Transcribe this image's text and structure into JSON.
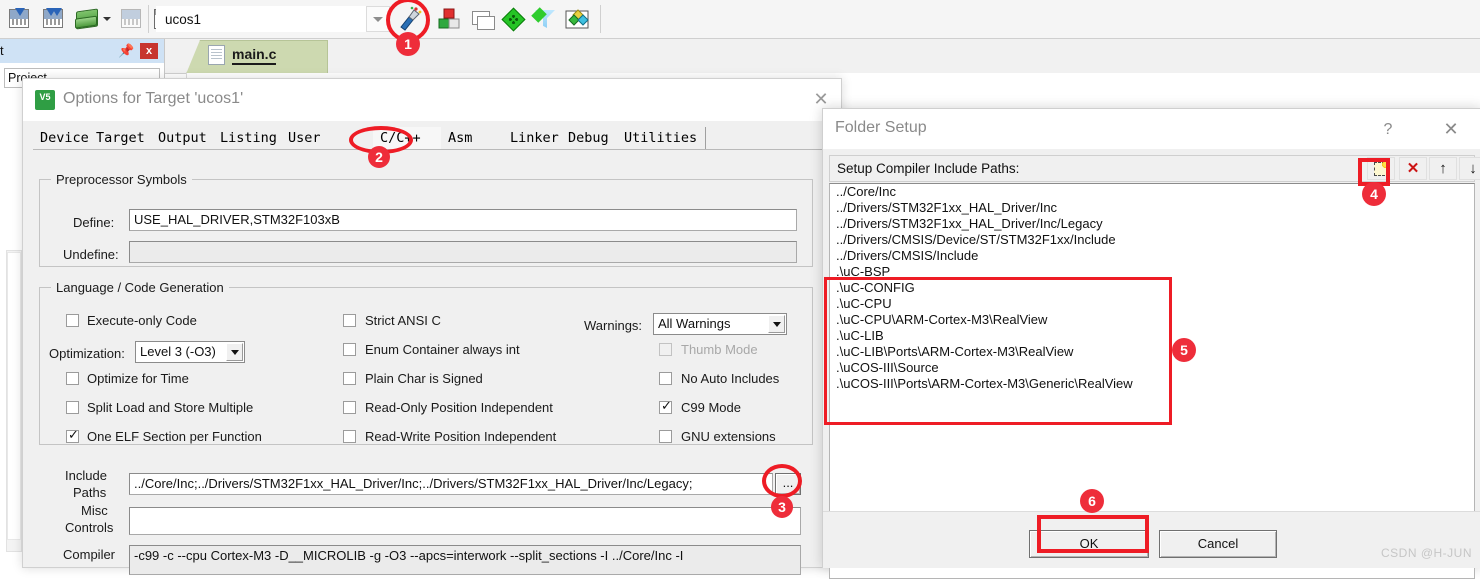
{
  "ide": {
    "toolbar": {
      "target_value": "ucos1",
      "icons": [
        {
          "name": "batch-build-icon"
        },
        {
          "name": "batch-rebuild-icon"
        },
        {
          "name": "manage-project-items-icon"
        },
        {
          "name": "dropdown-arrow-icon"
        },
        {
          "name": "clear-build-icon"
        },
        {
          "name": "load-download-icon"
        },
        {
          "name": "target-options-icon"
        },
        {
          "name": "manage-components-icon"
        },
        {
          "name": "multi-project-icon"
        },
        {
          "name": "configuration-wizard-icon"
        },
        {
          "name": "pack-installer-icon"
        },
        {
          "name": "pack-manager-icon"
        }
      ],
      "combo_arrow": "chevron-down-icon"
    },
    "project_panel": {
      "title": "t",
      "pin": "pin-icon",
      "close": "x",
      "combo_value": "Project"
    },
    "editor": {
      "tab_label": "main.c"
    }
  },
  "options_dialog": {
    "app_icon_text": "V5",
    "title": "Options for Target 'ucos1'",
    "close": "✕",
    "tabs": [
      {
        "label": "Device"
      },
      {
        "label": "Target"
      },
      {
        "label": "Output"
      },
      {
        "label": "Listing"
      },
      {
        "label": "User"
      },
      {
        "label": "C/C++"
      },
      {
        "label": "Asm"
      },
      {
        "label": "Linker"
      },
      {
        "label": "Debug"
      },
      {
        "label": "Utilities"
      }
    ],
    "active_tab": "C/C++",
    "preprocessor": {
      "legend": "Preprocessor Symbols",
      "define_label": "Define:",
      "define_value": "USE_HAL_DRIVER,STM32F103xB",
      "undefine_label": "Undefine:",
      "undefine_value": ""
    },
    "language": {
      "legend": "Language / Code Generation",
      "left_checks": [
        {
          "label": "Execute-only Code",
          "checked": false
        },
        {
          "label": "Optimize for Time",
          "checked": false
        },
        {
          "label": "Split Load and Store Multiple",
          "checked": false
        },
        {
          "label": "One ELF Section per Function",
          "checked": true
        }
      ],
      "optimization_label": "Optimization:",
      "optimization_value": "Level 3 (-O3)",
      "middle_checks": [
        {
          "label": "Strict ANSI C",
          "checked": false
        },
        {
          "label": "Enum Container always int",
          "checked": false
        },
        {
          "label": "Plain Char is Signed",
          "checked": false
        },
        {
          "label": "Read-Only Position Independent",
          "checked": false
        },
        {
          "label": "Read-Write Position Independent",
          "checked": false
        }
      ],
      "warnings_label": "Warnings:",
      "warnings_value": "All Warnings",
      "right_checks": [
        {
          "label": "Thumb Mode",
          "checked": false,
          "disabled": true
        },
        {
          "label": "No Auto Includes",
          "checked": false,
          "disabled": false
        },
        {
          "label": "C99 Mode",
          "checked": true,
          "disabled": false
        },
        {
          "label": "GNU extensions",
          "checked": false,
          "disabled": false
        }
      ]
    },
    "include_paths": {
      "label_line1": "Include",
      "label_line2": "Paths",
      "value": "../Core/Inc;../Drivers/STM32F1xx_HAL_Driver/Inc;../Drivers/STM32F1xx_HAL_Driver/Inc/Legacy;",
      "browse_button": "..."
    },
    "misc_controls": {
      "label_line1": "Misc",
      "label_line2": "Controls",
      "value": ""
    },
    "compiler_control": {
      "label": "Compiler",
      "value": "-c99 -c --cpu Cortex-M3 -D__MICROLIB -g -O3 --apcs=interwork --split_sections -I ../Core/Inc -I"
    }
  },
  "folder_dialog": {
    "title": "Folder Setup",
    "help": "?",
    "close": "✕",
    "toolbar_label": "Setup Compiler Include Paths:",
    "toolbar_buttons": [
      {
        "name": "new-path-icon",
        "glyph": ""
      },
      {
        "name": "delete-path-icon",
        "glyph": "✕"
      },
      {
        "name": "move-up-icon",
        "glyph": "↑"
      },
      {
        "name": "move-down-icon",
        "glyph": "↓"
      }
    ],
    "paths": [
      "../Core/Inc",
      "../Drivers/STM32F1xx_HAL_Driver/Inc",
      "../Drivers/STM32F1xx_HAL_Driver/Inc/Legacy",
      "../Drivers/CMSIS/Device/ST/STM32F1xx/Include",
      "../Drivers/CMSIS/Include",
      ".\\uC-BSP",
      ".\\uC-CONFIG",
      ".\\uC-CPU",
      ".\\uC-CPU\\ARM-Cortex-M3\\RealView",
      ".\\uC-LIB",
      ".\\uC-LIB\\Ports\\ARM-Cortex-M3\\RealView",
      ".\\uCOS-III\\Source",
      ".\\uCOS-III\\Ports\\ARM-Cortex-M3\\Generic\\RealView"
    ],
    "ok_label": "OK",
    "cancel_label": "Cancel"
  },
  "annotations": {
    "accent_color": "#ee2d3a",
    "markers": [
      {
        "number": "1"
      },
      {
        "number": "2"
      },
      {
        "number": "3"
      },
      {
        "number": "4"
      },
      {
        "number": "5"
      },
      {
        "number": "6"
      }
    ]
  },
  "watermark": "CSDN @H-JUN"
}
